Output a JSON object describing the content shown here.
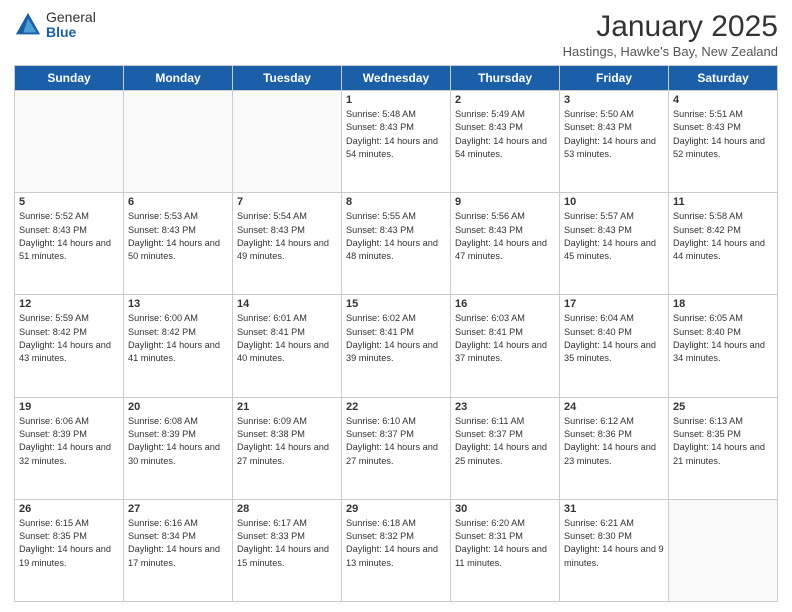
{
  "logo": {
    "general": "General",
    "blue": "Blue"
  },
  "header": {
    "title": "January 2025",
    "subtitle": "Hastings, Hawke's Bay, New Zealand"
  },
  "weekdays": [
    "Sunday",
    "Monday",
    "Tuesday",
    "Wednesday",
    "Thursday",
    "Friday",
    "Saturday"
  ],
  "weeks": [
    [
      {
        "day": "",
        "sunrise": "",
        "sunset": "",
        "daylight": ""
      },
      {
        "day": "",
        "sunrise": "",
        "sunset": "",
        "daylight": ""
      },
      {
        "day": "",
        "sunrise": "",
        "sunset": "",
        "daylight": ""
      },
      {
        "day": "1",
        "sunrise": "Sunrise: 5:48 AM",
        "sunset": "Sunset: 8:43 PM",
        "daylight": "Daylight: 14 hours and 54 minutes."
      },
      {
        "day": "2",
        "sunrise": "Sunrise: 5:49 AM",
        "sunset": "Sunset: 8:43 PM",
        "daylight": "Daylight: 14 hours and 54 minutes."
      },
      {
        "day": "3",
        "sunrise": "Sunrise: 5:50 AM",
        "sunset": "Sunset: 8:43 PM",
        "daylight": "Daylight: 14 hours and 53 minutes."
      },
      {
        "day": "4",
        "sunrise": "Sunrise: 5:51 AM",
        "sunset": "Sunset: 8:43 PM",
        "daylight": "Daylight: 14 hours and 52 minutes."
      }
    ],
    [
      {
        "day": "5",
        "sunrise": "Sunrise: 5:52 AM",
        "sunset": "Sunset: 8:43 PM",
        "daylight": "Daylight: 14 hours and 51 minutes."
      },
      {
        "day": "6",
        "sunrise": "Sunrise: 5:53 AM",
        "sunset": "Sunset: 8:43 PM",
        "daylight": "Daylight: 14 hours and 50 minutes."
      },
      {
        "day": "7",
        "sunrise": "Sunrise: 5:54 AM",
        "sunset": "Sunset: 8:43 PM",
        "daylight": "Daylight: 14 hours and 49 minutes."
      },
      {
        "day": "8",
        "sunrise": "Sunrise: 5:55 AM",
        "sunset": "Sunset: 8:43 PM",
        "daylight": "Daylight: 14 hours and 48 minutes."
      },
      {
        "day": "9",
        "sunrise": "Sunrise: 5:56 AM",
        "sunset": "Sunset: 8:43 PM",
        "daylight": "Daylight: 14 hours and 47 minutes."
      },
      {
        "day": "10",
        "sunrise": "Sunrise: 5:57 AM",
        "sunset": "Sunset: 8:43 PM",
        "daylight": "Daylight: 14 hours and 45 minutes."
      },
      {
        "day": "11",
        "sunrise": "Sunrise: 5:58 AM",
        "sunset": "Sunset: 8:42 PM",
        "daylight": "Daylight: 14 hours and 44 minutes."
      }
    ],
    [
      {
        "day": "12",
        "sunrise": "Sunrise: 5:59 AM",
        "sunset": "Sunset: 8:42 PM",
        "daylight": "Daylight: 14 hours and 43 minutes."
      },
      {
        "day": "13",
        "sunrise": "Sunrise: 6:00 AM",
        "sunset": "Sunset: 8:42 PM",
        "daylight": "Daylight: 14 hours and 41 minutes."
      },
      {
        "day": "14",
        "sunrise": "Sunrise: 6:01 AM",
        "sunset": "Sunset: 8:41 PM",
        "daylight": "Daylight: 14 hours and 40 minutes."
      },
      {
        "day": "15",
        "sunrise": "Sunrise: 6:02 AM",
        "sunset": "Sunset: 8:41 PM",
        "daylight": "Daylight: 14 hours and 39 minutes."
      },
      {
        "day": "16",
        "sunrise": "Sunrise: 6:03 AM",
        "sunset": "Sunset: 8:41 PM",
        "daylight": "Daylight: 14 hours and 37 minutes."
      },
      {
        "day": "17",
        "sunrise": "Sunrise: 6:04 AM",
        "sunset": "Sunset: 8:40 PM",
        "daylight": "Daylight: 14 hours and 35 minutes."
      },
      {
        "day": "18",
        "sunrise": "Sunrise: 6:05 AM",
        "sunset": "Sunset: 8:40 PM",
        "daylight": "Daylight: 14 hours and 34 minutes."
      }
    ],
    [
      {
        "day": "19",
        "sunrise": "Sunrise: 6:06 AM",
        "sunset": "Sunset: 8:39 PM",
        "daylight": "Daylight: 14 hours and 32 minutes."
      },
      {
        "day": "20",
        "sunrise": "Sunrise: 6:08 AM",
        "sunset": "Sunset: 8:39 PM",
        "daylight": "Daylight: 14 hours and 30 minutes."
      },
      {
        "day": "21",
        "sunrise": "Sunrise: 6:09 AM",
        "sunset": "Sunset: 8:38 PM",
        "daylight": "Daylight: 14 hours and 27 minutes."
      },
      {
        "day": "22",
        "sunrise": "Sunrise: 6:10 AM",
        "sunset": "Sunset: 8:37 PM",
        "daylight": "Daylight: 14 hours and 27 minutes."
      },
      {
        "day": "23",
        "sunrise": "Sunrise: 6:11 AM",
        "sunset": "Sunset: 8:37 PM",
        "daylight": "Daylight: 14 hours and 25 minutes."
      },
      {
        "day": "24",
        "sunrise": "Sunrise: 6:12 AM",
        "sunset": "Sunset: 8:36 PM",
        "daylight": "Daylight: 14 hours and 23 minutes."
      },
      {
        "day": "25",
        "sunrise": "Sunrise: 6:13 AM",
        "sunset": "Sunset: 8:35 PM",
        "daylight": "Daylight: 14 hours and 21 minutes."
      }
    ],
    [
      {
        "day": "26",
        "sunrise": "Sunrise: 6:15 AM",
        "sunset": "Sunset: 8:35 PM",
        "daylight": "Daylight: 14 hours and 19 minutes."
      },
      {
        "day": "27",
        "sunrise": "Sunrise: 6:16 AM",
        "sunset": "Sunset: 8:34 PM",
        "daylight": "Daylight: 14 hours and 17 minutes."
      },
      {
        "day": "28",
        "sunrise": "Sunrise: 6:17 AM",
        "sunset": "Sunset: 8:33 PM",
        "daylight": "Daylight: 14 hours and 15 minutes."
      },
      {
        "day": "29",
        "sunrise": "Sunrise: 6:18 AM",
        "sunset": "Sunset: 8:32 PM",
        "daylight": "Daylight: 14 hours and 13 minutes."
      },
      {
        "day": "30",
        "sunrise": "Sunrise: 6:20 AM",
        "sunset": "Sunset: 8:31 PM",
        "daylight": "Daylight: 14 hours and 11 minutes."
      },
      {
        "day": "31",
        "sunrise": "Sunrise: 6:21 AM",
        "sunset": "Sunset: 8:30 PM",
        "daylight": "Daylight: 14 hours and 9 minutes."
      },
      {
        "day": "",
        "sunrise": "",
        "sunset": "",
        "daylight": ""
      }
    ]
  ]
}
